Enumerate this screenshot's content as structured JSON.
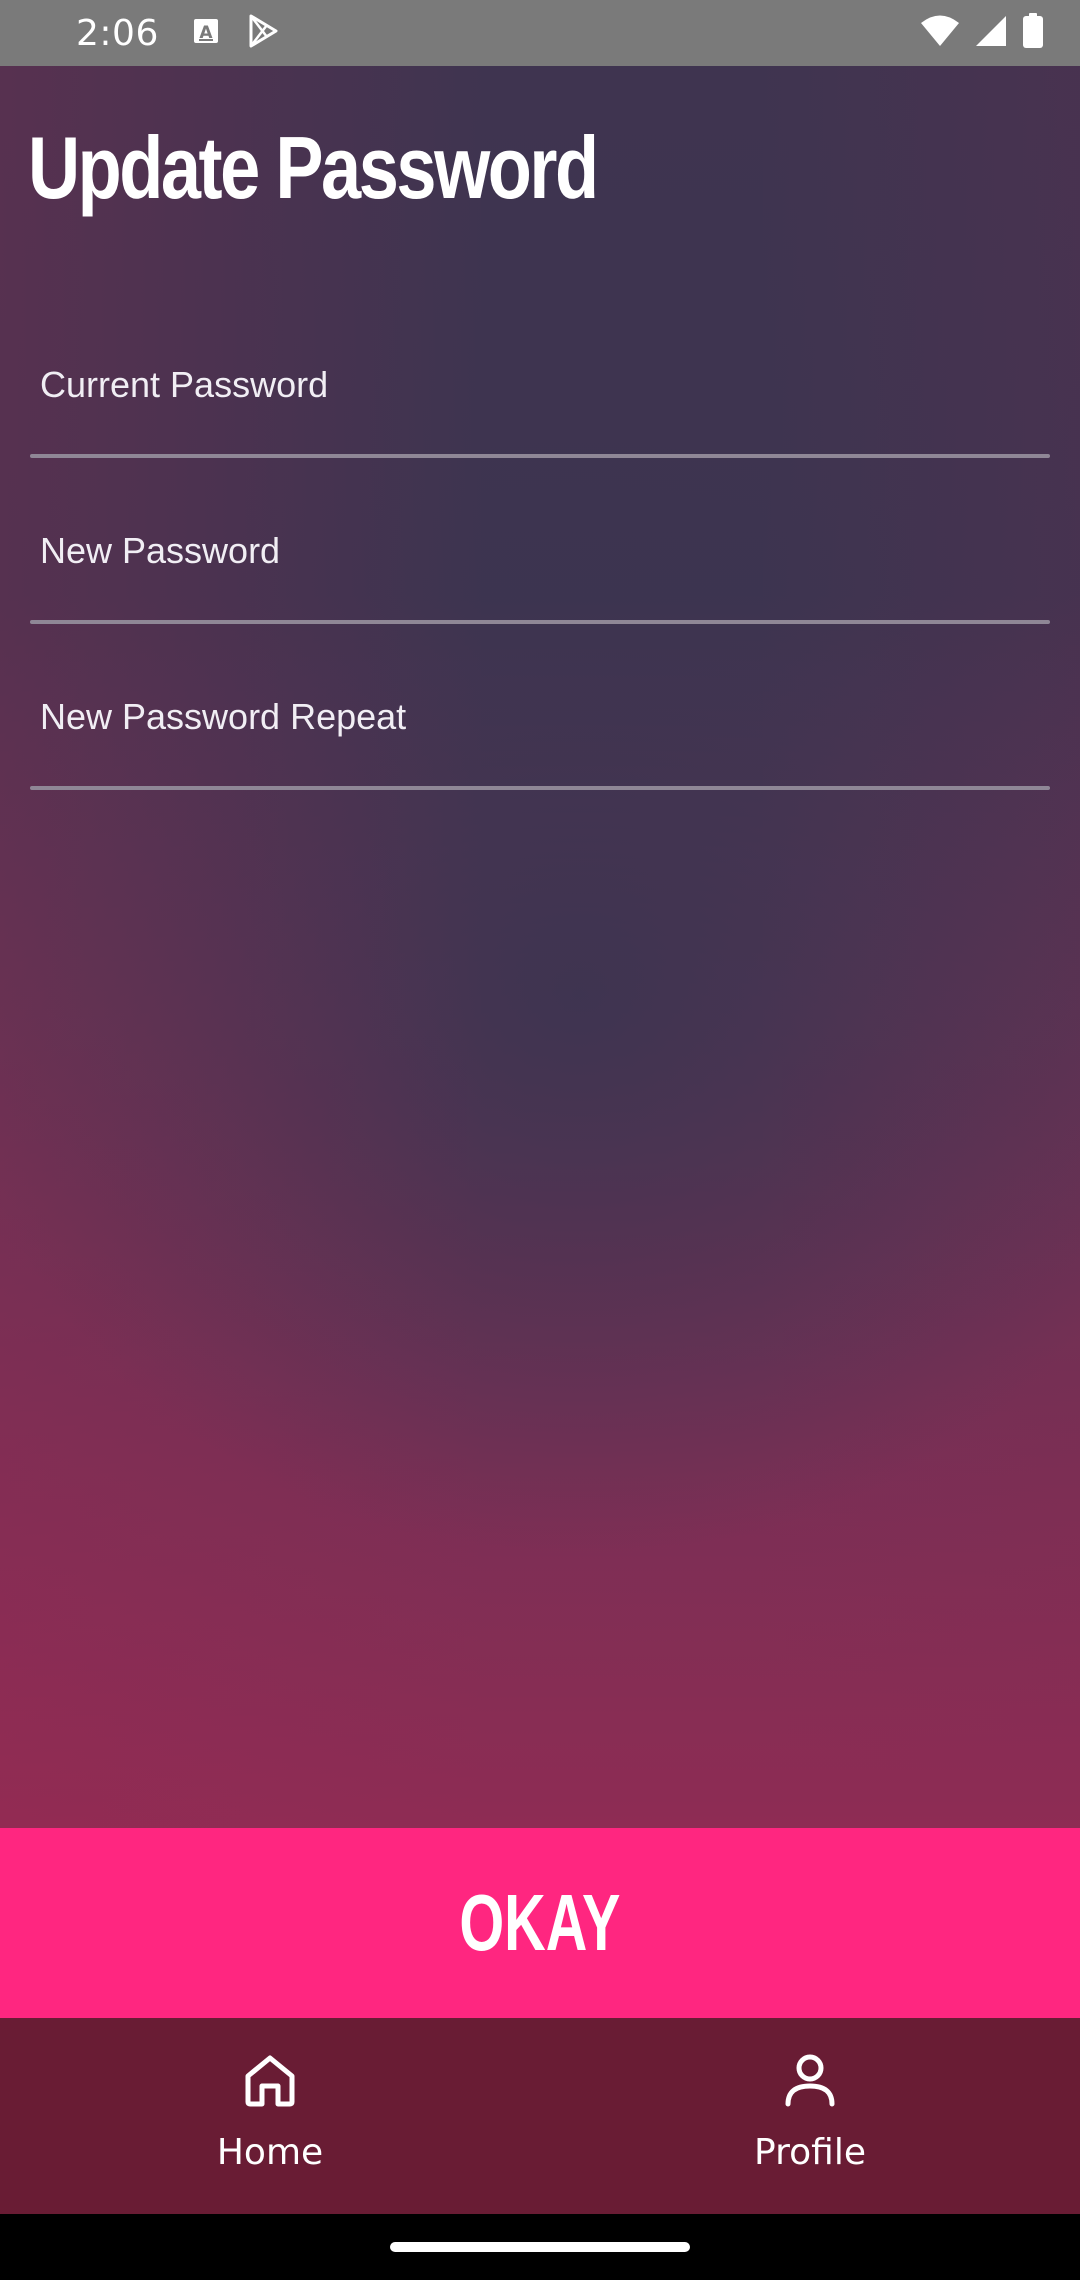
{
  "status_bar": {
    "time": "2:06",
    "left_icons": [
      "keyboard-a-icon",
      "play-store-icon"
    ],
    "right_icons": [
      "wifi-icon",
      "cell-signal-icon",
      "battery-icon"
    ]
  },
  "page": {
    "title": "Update Password"
  },
  "form": {
    "fields": [
      {
        "label": "Current Password",
        "value": ""
      },
      {
        "label": "New Password",
        "value": ""
      },
      {
        "label": "New Password Repeat",
        "value": ""
      }
    ],
    "submit_label": "OKAY"
  },
  "bottom_nav": {
    "items": [
      {
        "label": "Home",
        "icon": "home-icon"
      },
      {
        "label": "Profile",
        "icon": "person-icon"
      }
    ]
  },
  "colors": {
    "accent": "#ff2680",
    "nav_background": "#691c34",
    "background_top": "#3f3450",
    "background_bottom": "#8e2c54"
  }
}
